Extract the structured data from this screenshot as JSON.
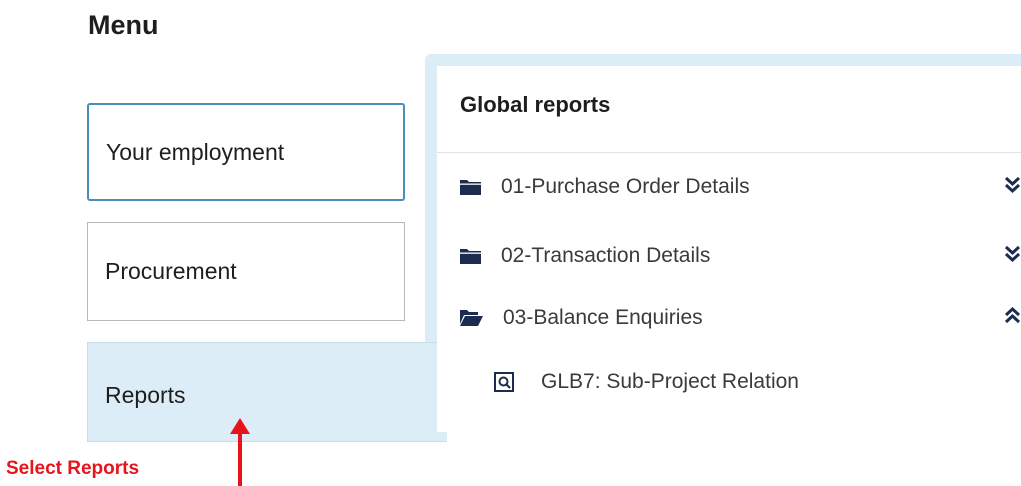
{
  "menu": {
    "title": "Menu",
    "items": [
      {
        "label": "Your employment"
      },
      {
        "label": "Procurement"
      },
      {
        "label": "Reports"
      }
    ]
  },
  "panel": {
    "title": "Global reports",
    "folders": [
      {
        "label": "01-Purchase Order Details",
        "icon": "folder-closed-icon",
        "state": "collapsed"
      },
      {
        "label": "02-Transaction Details",
        "icon": "folder-closed-icon",
        "state": "collapsed"
      },
      {
        "label": "03-Balance Enquiries",
        "icon": "folder-open-icon",
        "state": "expanded"
      }
    ],
    "reports": [
      {
        "label": "GLB7: Sub-Project Relation",
        "icon": "report-search-icon"
      }
    ]
  },
  "annotation": {
    "label": "Select Reports"
  },
  "colors": {
    "accent_border": "#4a8db8",
    "selected_bg": "#dcedf7",
    "icon_navy": "#1b2c4e",
    "annotation_red": "#e8141b"
  }
}
